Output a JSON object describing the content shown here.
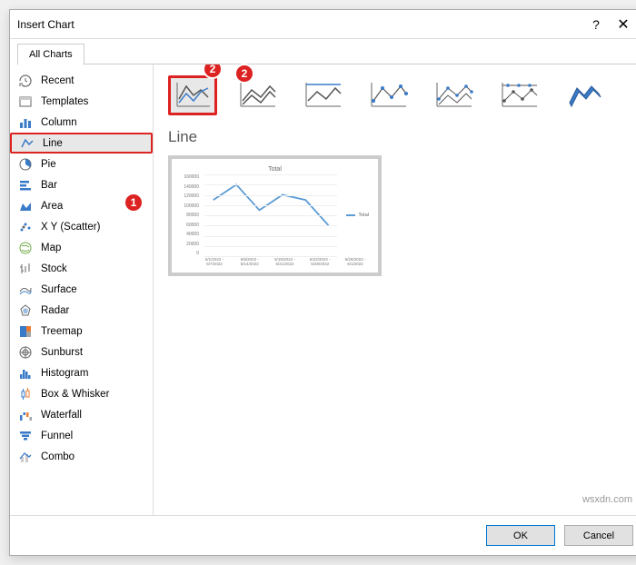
{
  "dialog": {
    "title": "Insert Chart",
    "help": "?",
    "close": "✕"
  },
  "tab": {
    "all_charts": "All Charts"
  },
  "sidebar": {
    "items": [
      {
        "label": "Recent",
        "icon": "recent"
      },
      {
        "label": "Templates",
        "icon": "templates"
      },
      {
        "label": "Column",
        "icon": "column"
      },
      {
        "label": "Line",
        "icon": "line",
        "selected": true
      },
      {
        "label": "Pie",
        "icon": "pie"
      },
      {
        "label": "Bar",
        "icon": "bar"
      },
      {
        "label": "Area",
        "icon": "area"
      },
      {
        "label": "X Y (Scatter)",
        "icon": "scatter"
      },
      {
        "label": "Map",
        "icon": "map"
      },
      {
        "label": "Stock",
        "icon": "stock"
      },
      {
        "label": "Surface",
        "icon": "surface"
      },
      {
        "label": "Radar",
        "icon": "radar"
      },
      {
        "label": "Treemap",
        "icon": "treemap"
      },
      {
        "label": "Sunburst",
        "icon": "sunburst"
      },
      {
        "label": "Histogram",
        "icon": "histogram"
      },
      {
        "label": "Box & Whisker",
        "icon": "box"
      },
      {
        "label": "Waterfall",
        "icon": "waterfall"
      },
      {
        "label": "Funnel",
        "icon": "funnel"
      },
      {
        "label": "Combo",
        "icon": "combo"
      }
    ]
  },
  "main": {
    "heading": "Line",
    "preview_title": "Total",
    "legend": "Total"
  },
  "footer": {
    "ok": "OK",
    "cancel": "Cancel"
  },
  "badges": {
    "one": "1",
    "two": "2"
  },
  "watermark": "wsxdn.com",
  "chart_data": {
    "type": "line",
    "title": "Total",
    "series": [
      {
        "name": "Total",
        "values": [
          110000,
          140000,
          90000,
          120000,
          110000,
          60000
        ]
      }
    ],
    "categories": [
      "5/1/2022 - 5/7/2022",
      "5/8/2022 - 5/14/2022",
      "5/15/2022 - 5/21/2022",
      "5/22/2022 - 5/28/2022",
      "5/29/2022 - 6/1/2022"
    ],
    "y_ticks": [
      0,
      20000,
      40000,
      60000,
      80000,
      100000,
      120000,
      140000,
      160000
    ],
    "ylim": [
      0,
      160000
    ]
  }
}
